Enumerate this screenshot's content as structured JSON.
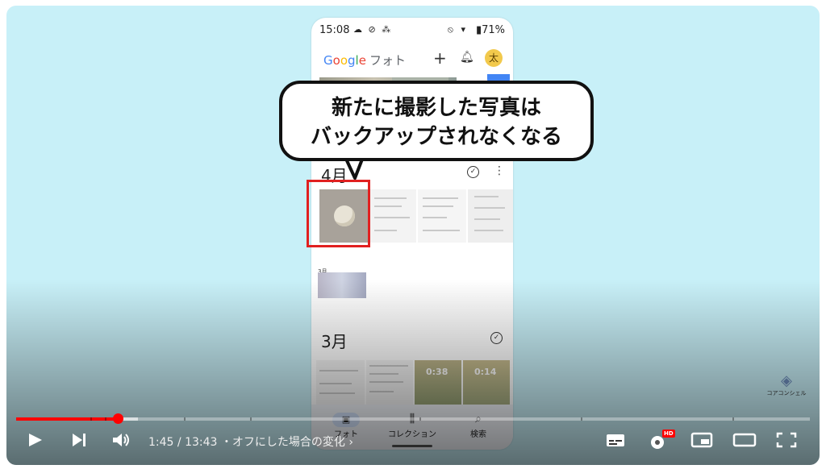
{
  "phone": {
    "status_time": "15:08",
    "status_left_icons": "☁ ⊘ ⁂",
    "status_right_icons": "⦸ ▾",
    "battery": "▮71%",
    "app_logo": [
      "G",
      "o",
      "o",
      "g",
      "l",
      "e"
    ],
    "app_name": "フォト",
    "avatar_text": "太",
    "month_april": "4月",
    "month_march": "3月",
    "mini_label": "3月",
    "clock_text_1": "0:38",
    "clock_text_2": "0:14",
    "nav": [
      {
        "label": "フォト"
      },
      {
        "label": "コレクション"
      },
      {
        "label": "検索"
      }
    ]
  },
  "callout": {
    "line1": "新たに撮影した写真は",
    "line2": "バックアップされなくなる"
  },
  "brand": {
    "name": "コアコンシェル"
  },
  "player": {
    "time_current": "1:45",
    "time_total": "13:43",
    "chapter": "・オフにした場合の変化",
    "chapter_arrow": "›",
    "progress_fraction": 0.128,
    "buffer_fraction": 0.153,
    "quality_badge": "HD"
  },
  "colors": {
    "progress": "#ff0000",
    "callout_border": "#111111",
    "highlight": "#e12020"
  }
}
